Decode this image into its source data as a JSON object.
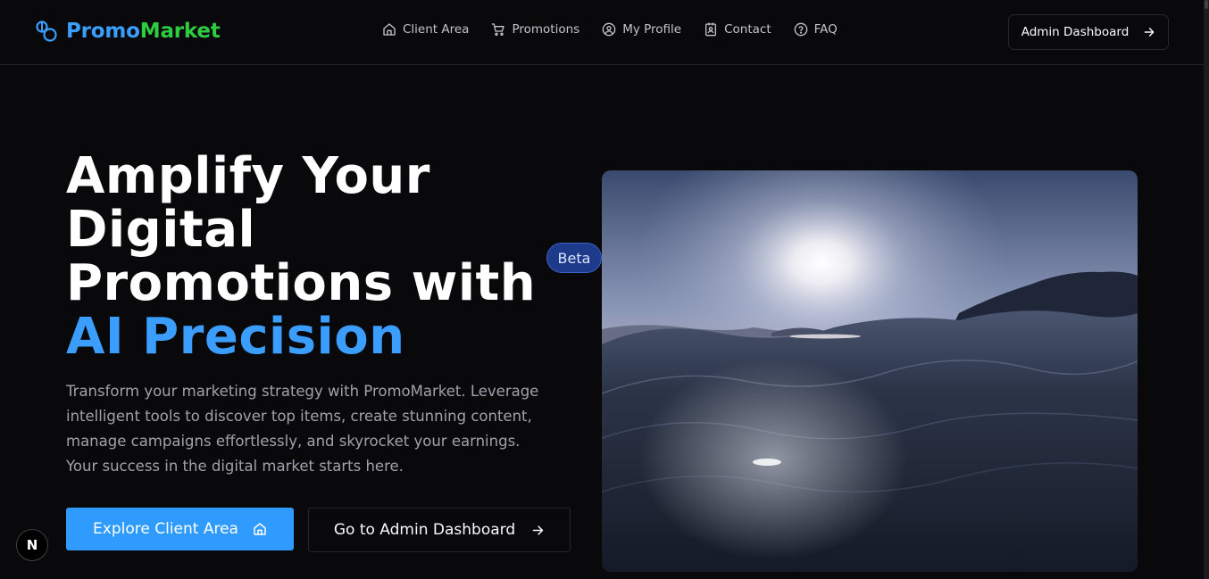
{
  "brand": {
    "name_part1": "Promo",
    "name_part2": "Market"
  },
  "nav": {
    "items": [
      {
        "label": "Client Area",
        "icon": "home-icon"
      },
      {
        "label": "Promotions",
        "icon": "cart-icon"
      },
      {
        "label": "My Profile",
        "icon": "user-circle-icon"
      },
      {
        "label": "Contact",
        "icon": "contact-card-icon"
      },
      {
        "label": "FAQ",
        "icon": "help-circle-icon"
      }
    ]
  },
  "header": {
    "admin_button": "Admin Dashboard"
  },
  "hero": {
    "title_lines": [
      "Amplify Your",
      "Digital",
      "Promotions with"
    ],
    "title_accent": "AI Precision",
    "description": "Transform your marketing strategy with PromoMarket. Leverage intelligent tools to discover top items, create stunning content, manage campaigns effortlessly, and skyrocket your earnings. Your success in the digital market starts here.",
    "primary_button": "Explore Client Area",
    "secondary_button": "Go to Admin Dashboard",
    "badge": "Beta"
  },
  "dev_badge": "N",
  "colors": {
    "accent": "#3b9eff",
    "brand_green": "#2ecc40",
    "background": "#09090b"
  }
}
